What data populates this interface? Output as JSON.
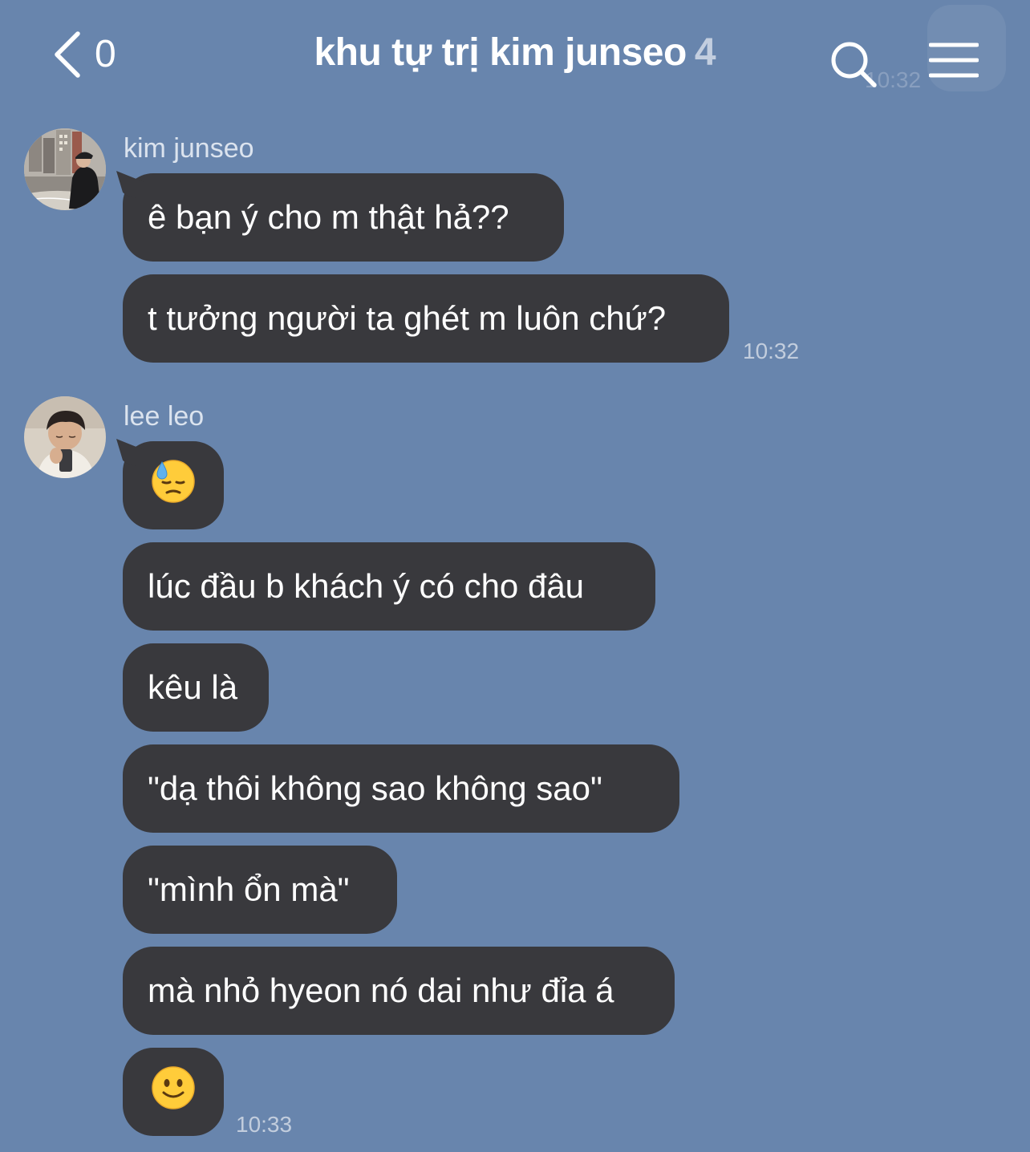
{
  "header": {
    "back_count": "0",
    "title": "khu tự trị kim junseo",
    "member_count": "4",
    "ghost_time": "10:32"
  },
  "messages": [
    {
      "sender": "kim junseo",
      "bubbles": [
        "ê bạn ý cho m thật hả??",
        "t tưởng người ta ghét m luôn chứ?"
      ],
      "time": "10:32"
    },
    {
      "sender": "lee leo",
      "bubbles": [
        "😓",
        "lúc đầu b khách ý có cho đâu",
        "kêu là",
        "\"dạ thôi không sao không sao\"",
        "\"mình ổn mà\"",
        "mà nhỏ hyeon nó dai như đỉa á",
        "🙂"
      ],
      "time": "10:33"
    }
  ],
  "icons": {
    "back": "chevron-left-icon",
    "search": "search-icon",
    "menu": "hamburger-menu-icon"
  },
  "colors": {
    "background": "#6885ad",
    "bubble": "#39393d",
    "text": "#ffffff",
    "timestamp": "#c2cddd"
  }
}
